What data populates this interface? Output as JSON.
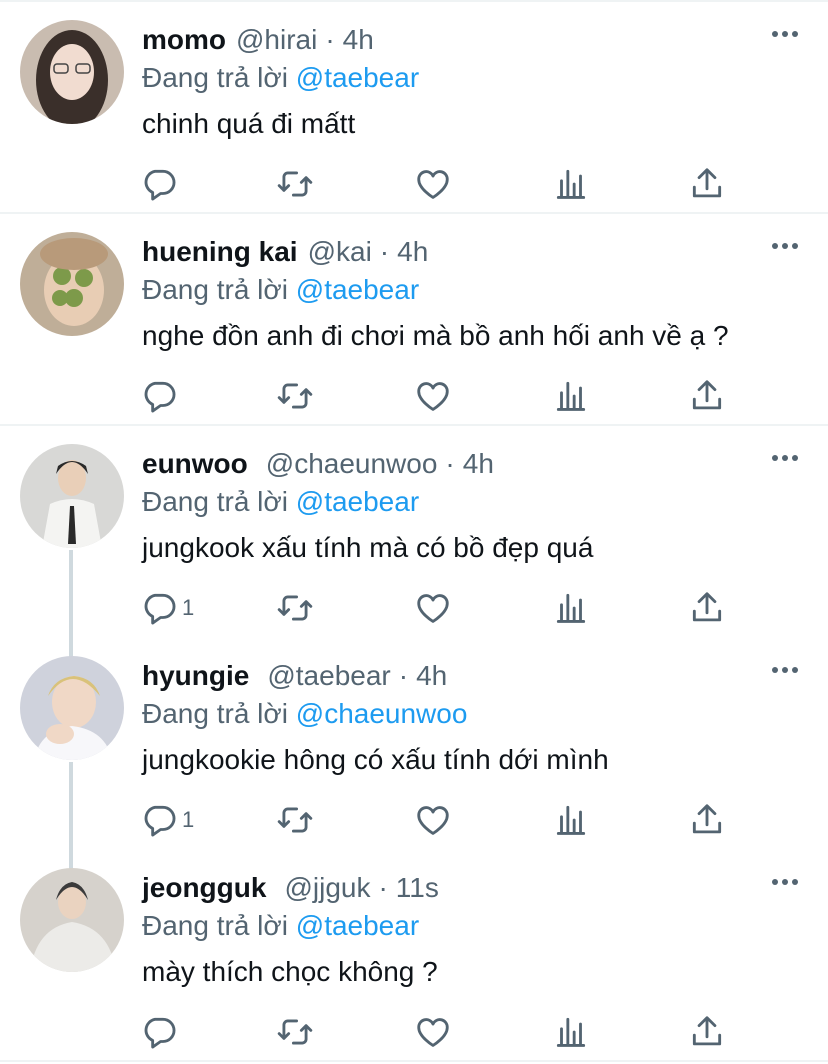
{
  "tweets": [
    {
      "name": "momo",
      "handle": "@hirai",
      "dot": "·",
      "time": "4h",
      "replying_prefix": "Đang trả lời",
      "replying_to": "@taebear",
      "text": "chinh quá đi mấtt",
      "reply_count": "",
      "avatar_bg": "#c9bcb0",
      "avatar_accent": "#3a2f2a"
    },
    {
      "name": "huening kai",
      "handle": "@kai",
      "dot": "·",
      "time": "4h",
      "replying_prefix": "Đang trả lời",
      "replying_to": "@taebear",
      "text": "nghe đồn anh đi chơi mà bồ anh hối anh về ạ ?",
      "reply_count": "",
      "avatar_bg": "#bfae98",
      "avatar_accent": "#7d9a4a"
    },
    {
      "name": "eunwoo",
      "handle": "@chaeunwoo",
      "dot": "·",
      "time": "4h",
      "replying_prefix": "Đang trả lời",
      "replying_to": "@taebear",
      "text": "jungkook xấu tính mà có bồ đẹp quá",
      "reply_count": "1",
      "avatar_bg": "#d8d8d6",
      "avatar_accent": "#2a2a2a"
    },
    {
      "name": "hyungie",
      "handle": "@taebear",
      "dot": "·",
      "time": "4h",
      "replying_prefix": "Đang trả lời",
      "replying_to": "@chaeunwoo",
      "text": "jungkookie hông có xấu tính dới mình",
      "reply_count": "1",
      "avatar_bg": "#cfd2dc",
      "avatar_accent": "#d9c27a"
    },
    {
      "name": "jeongguk",
      "handle": "@jjguk",
      "dot": "·",
      "time": "11s",
      "replying_prefix": "Đang trả lời",
      "replying_to": "@taebear",
      "text": "mày thích chọc không ?",
      "reply_count": "",
      "avatar_bg": "#d6d2cc",
      "avatar_accent": "#3b3b3b"
    }
  ],
  "colors": {
    "text_primary": "#0f1419",
    "text_secondary": "#536471",
    "link": "#1d9bf0",
    "divider": "#eff3f4",
    "thread_line": "#cfd9de"
  },
  "icons": {
    "reply": "reply-icon",
    "retweet": "retweet-icon",
    "like": "heart-icon",
    "analytics": "analytics-icon",
    "share": "share-icon",
    "more": "more-icon"
  }
}
